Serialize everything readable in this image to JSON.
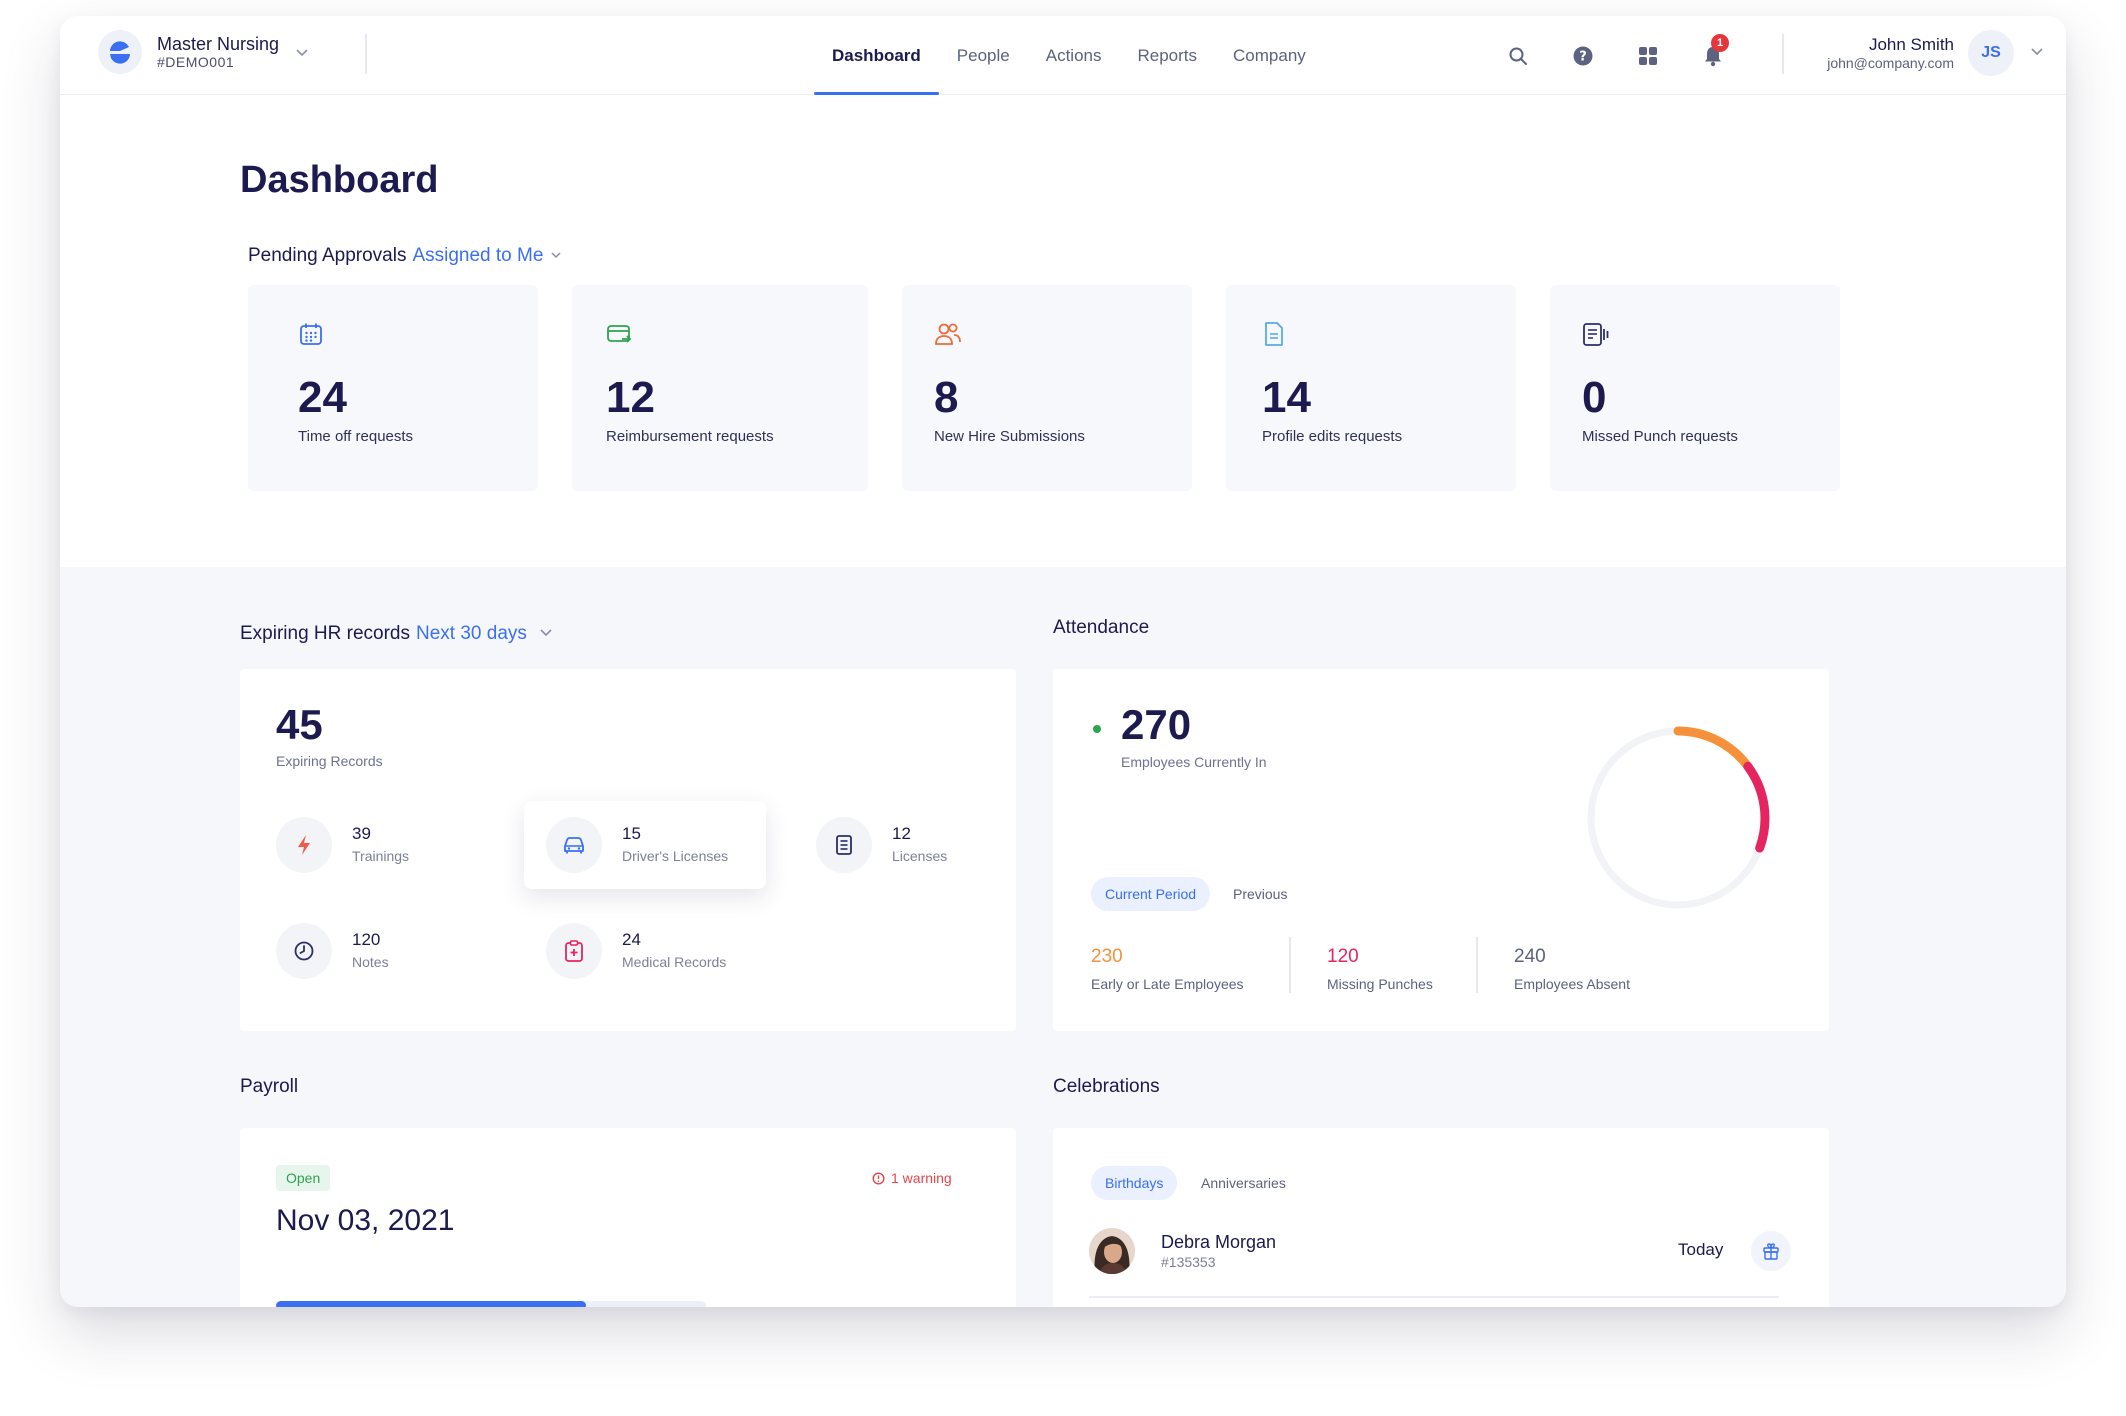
{
  "org": {
    "name": "Master Nursing",
    "code": "#DEMO001"
  },
  "nav": {
    "items": [
      {
        "label": "Dashboard",
        "active": true
      },
      {
        "label": "People",
        "active": false
      },
      {
        "label": "Actions",
        "active": false
      },
      {
        "label": "Reports",
        "active": false
      },
      {
        "label": "Company",
        "active": false
      }
    ]
  },
  "header_icons": [
    "search-icon",
    "help-icon",
    "apps-grid-icon",
    "bell-icon"
  ],
  "notifications": {
    "count": "1"
  },
  "user": {
    "name": "John Smith",
    "email": "john@company.com",
    "initials": "JS"
  },
  "page": {
    "title": "Dashboard"
  },
  "pending": {
    "heading": "Pending Approvals",
    "filter": "Assigned to Me",
    "cards": [
      {
        "value": "24",
        "label": "Time off requests",
        "icon": "calendar-icon",
        "color": "#3a6ff2"
      },
      {
        "value": "12",
        "label": "Reimbursement requests",
        "icon": "card-transfer-icon",
        "color": "#2fa34e"
      },
      {
        "value": "8",
        "label": "New Hire Submissions",
        "icon": "users-icon",
        "color": "#f06a3a"
      },
      {
        "value": "14",
        "label": "Profile edits requests",
        "icon": "document-icon",
        "color": "#5aa8f0"
      },
      {
        "value": "0",
        "label": "Missed Punch requests",
        "icon": "punch-card-icon",
        "color": "#2a2f6b"
      }
    ]
  },
  "expiring": {
    "heading": "Expiring HR records",
    "filter": "Next 30 days",
    "total": "45",
    "total_label": "Expiring Records",
    "items": [
      {
        "value": "39",
        "label": "Trainings",
        "icon": "lightning-icon",
        "color": "#f05a4a"
      },
      {
        "value": "15",
        "label": "Driver's Licenses",
        "icon": "car-icon",
        "color": "#3a6ff2"
      },
      {
        "value": "12",
        "label": "Licenses",
        "icon": "license-doc-icon",
        "color": "#2a2f6b"
      },
      {
        "value": "120",
        "label": "Notes",
        "icon": "clock-icon",
        "color": "#2a2f6b"
      },
      {
        "value": "24",
        "label": "Medical Records",
        "icon": "medical-clipboard-icon",
        "color": "#e5255f"
      }
    ]
  },
  "attendance": {
    "heading": "Attendance",
    "value": "270",
    "value_label": "Employees Currently In",
    "status_color": "#2fa34e",
    "periods": [
      "Current Period",
      "Previous"
    ],
    "active_period": "Current Period",
    "stats": [
      {
        "value": "230",
        "label": "Early or Late Employees",
        "color": "#f5913a"
      },
      {
        "value": "120",
        "label": "Missing Punches",
        "color": "#e5255f"
      },
      {
        "value": "240",
        "label": "Employees Absent",
        "color": "#5c6280"
      }
    ]
  },
  "payroll": {
    "heading": "Payroll",
    "status": "Open",
    "warning": "1 warning",
    "date": "Nov 03, 2021",
    "progress": 0.72
  },
  "celebrations": {
    "heading": "Celebrations",
    "tabs": [
      "Birthdays",
      "Anniversaries"
    ],
    "active_tab": "Birthdays",
    "people": [
      {
        "name": "Debra Morgan",
        "id": "#135353",
        "when": "Today"
      }
    ]
  }
}
